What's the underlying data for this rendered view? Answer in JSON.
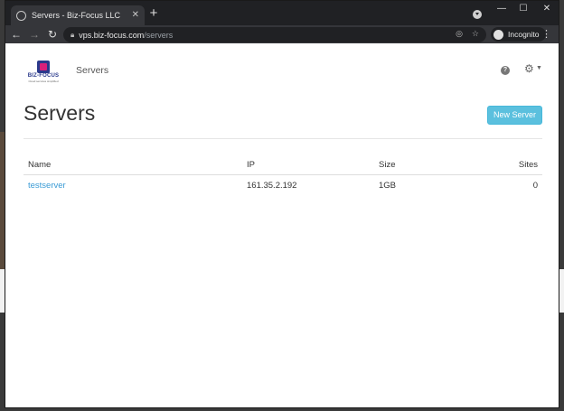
{
  "browser": {
    "tab_title": "Servers - Biz-Focus LLC",
    "tab_close": "✕",
    "new_tab": "+",
    "url_host": "vps.biz-focus.com",
    "url_path": "/servers",
    "incognito_label": "Incognito",
    "window_controls": [
      "—",
      "☐",
      "✕"
    ]
  },
  "nav": {
    "logo_text": "BIZ-FOCUS",
    "logo_sub": "Cloud services simplified",
    "section": "Servers"
  },
  "page": {
    "title": "Servers",
    "new_button": "New Server"
  },
  "table": {
    "columns": [
      "Name",
      "IP",
      "Size",
      "Sites"
    ],
    "rows": [
      {
        "name": "testserver",
        "ip": "161.35.2.192",
        "size": "1GB",
        "sites": "0"
      }
    ]
  },
  "colors": {
    "accent": "#5bc0de",
    "link": "#3a9bd5",
    "brand_primary": "#2b3a8c",
    "brand_secondary": "#d9207a"
  },
  "icons": {
    "favicon": "globe-icon",
    "back": "arrow-left-icon",
    "forward": "arrow-right-icon",
    "reload": "reload-icon",
    "lock": "lock-icon",
    "eye_off": "eye-off-icon",
    "star": "star-icon",
    "help": "help-icon",
    "settings": "gear-icon",
    "menu": "kebab-icon"
  }
}
